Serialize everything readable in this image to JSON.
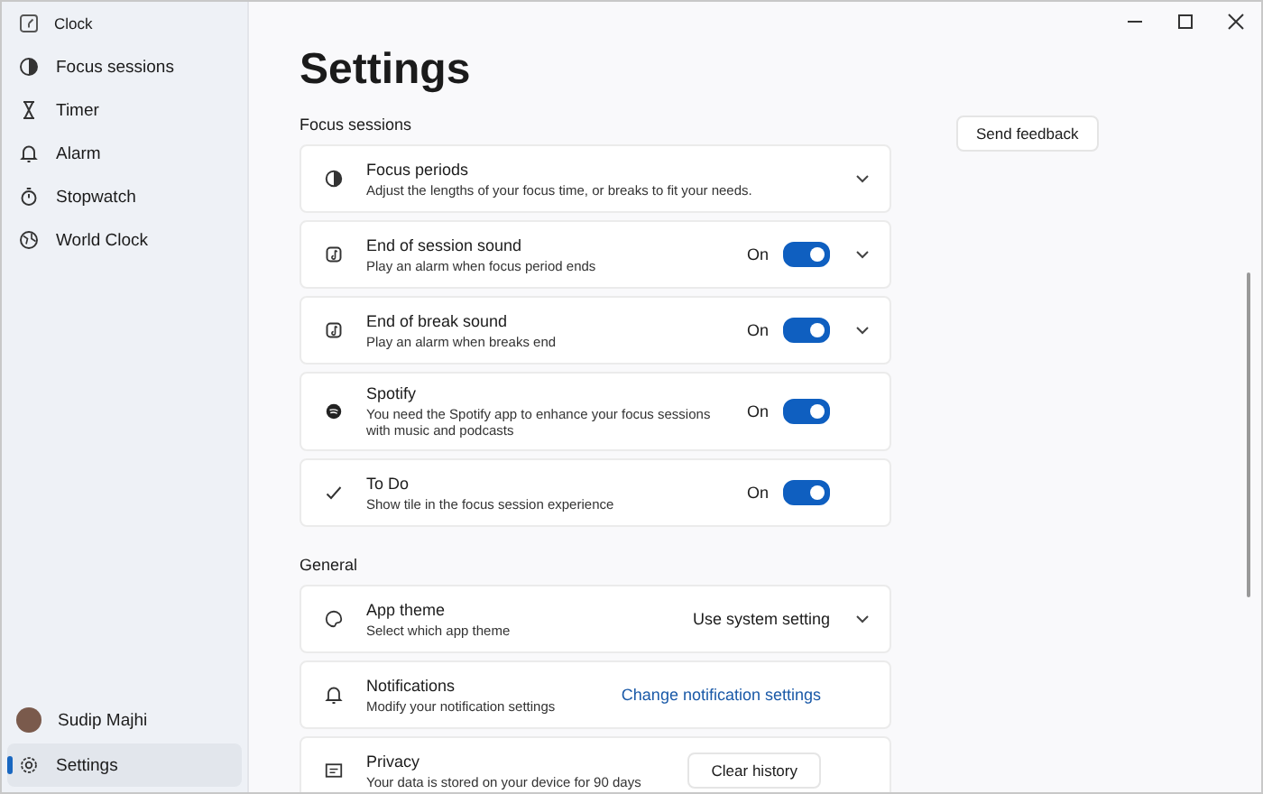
{
  "window": {
    "title": "Clock"
  },
  "sidebar": {
    "items": [
      {
        "label": "Focus sessions",
        "selected": false
      },
      {
        "label": "Timer",
        "selected": false
      },
      {
        "label": "Alarm",
        "selected": false
      },
      {
        "label": "Stopwatch",
        "selected": false
      },
      {
        "label": "World Clock",
        "selected": false
      }
    ],
    "user": {
      "name": "Sudip Majhi"
    },
    "footer_items": [
      {
        "label": "Settings",
        "selected": true
      }
    ]
  },
  "page": {
    "title": "Settings",
    "feedback_button": "Send feedback"
  },
  "sections": [
    {
      "heading": "Focus sessions",
      "rows": [
        {
          "kind": "expander",
          "title": "Focus periods",
          "description": "Adjust the lengths of your focus time, or breaks to fit your needs."
        },
        {
          "kind": "toggle",
          "title": "End of session sound",
          "description": "Play an alarm when focus period ends",
          "state_label": "On",
          "on": true,
          "expandable": true
        },
        {
          "kind": "toggle",
          "title": "End of break sound",
          "description": "Play an alarm when breaks end",
          "state_label": "On",
          "on": true,
          "expandable": true
        },
        {
          "kind": "toggle",
          "title": "Spotify",
          "description": "You need the Spotify app to enhance your focus sessions with music and podcasts",
          "state_label": "On",
          "on": true,
          "expandable": false
        },
        {
          "kind": "toggle",
          "title": "To Do",
          "description": "Show tile in the focus session experience",
          "state_label": "On",
          "on": true,
          "expandable": false
        }
      ]
    },
    {
      "heading": "General",
      "rows": [
        {
          "kind": "select",
          "title": "App theme",
          "description": "Select which app theme",
          "value": "Use system setting"
        },
        {
          "kind": "link",
          "title": "Notifications",
          "description": "Modify your notification settings",
          "link": "Change notification settings"
        },
        {
          "kind": "button",
          "title": "Privacy",
          "description": "Your data is stored on your device for 90 days",
          "button": "Clear history"
        }
      ]
    }
  ]
}
